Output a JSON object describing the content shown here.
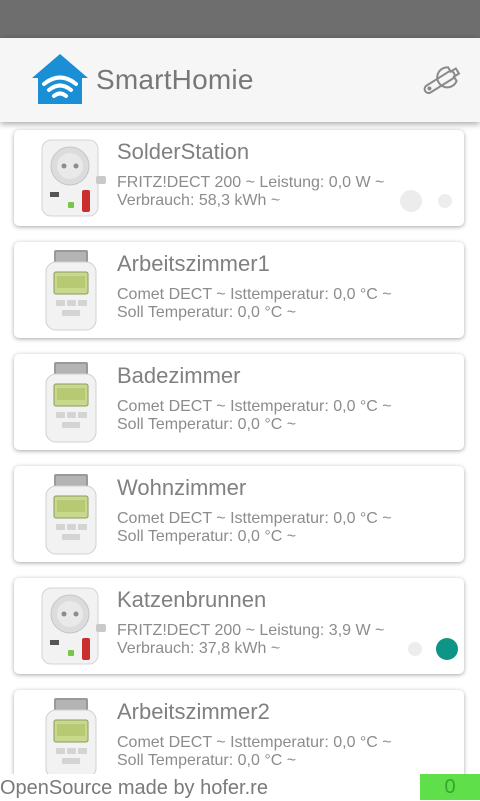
{
  "header": {
    "app_title": "SmartHomie",
    "logo_icon": "wifi-house-icon",
    "settings_icon": "wrench-icon"
  },
  "devices": [
    {
      "name": "SolderStation",
      "description": "FRITZ!DECT 200 ~ Leistung: 0,0 W ~ Verbrauch: 58,3 kWh ~",
      "type": "plug",
      "switch_state": "off"
    },
    {
      "name": "Arbeitszimmer1",
      "description": "Comet DECT ~ Isttemperatur: 0,0 °C ~ Soll Temperatur: 0,0 °C ~",
      "type": "thermostat"
    },
    {
      "name": "Badezimmer",
      "description": "Comet DECT ~ Isttemperatur: 0,0 °C ~ Soll Temperatur: 0,0 °C ~",
      "type": "thermostat"
    },
    {
      "name": "Wohnzimmer",
      "description": "Comet DECT ~ Isttemperatur: 0,0 °C ~ Soll Temperatur: 0,0 °C ~",
      "type": "thermostat"
    },
    {
      "name": "Katzenbrunnen",
      "description": "FRITZ!DECT 200 ~ Leistung: 3,9 W ~ Verbrauch: 37,8 kWh ~",
      "type": "plug",
      "switch_state": "on"
    },
    {
      "name": "Arbeitszimmer2",
      "description": "Comet DECT ~ Isttemperatur: 0,0 °C ~ Soll Temperatur: 0,0 °C ~",
      "type": "thermostat"
    }
  ],
  "footer": {
    "credit": "OpenSource made by hofer.re",
    "badge_value": "0"
  },
  "colors": {
    "status_bar": "#6e6e6e",
    "logo_blue": "#1a8fd6",
    "switch_on": "#0e9586",
    "badge_green": "#5fe04a"
  }
}
